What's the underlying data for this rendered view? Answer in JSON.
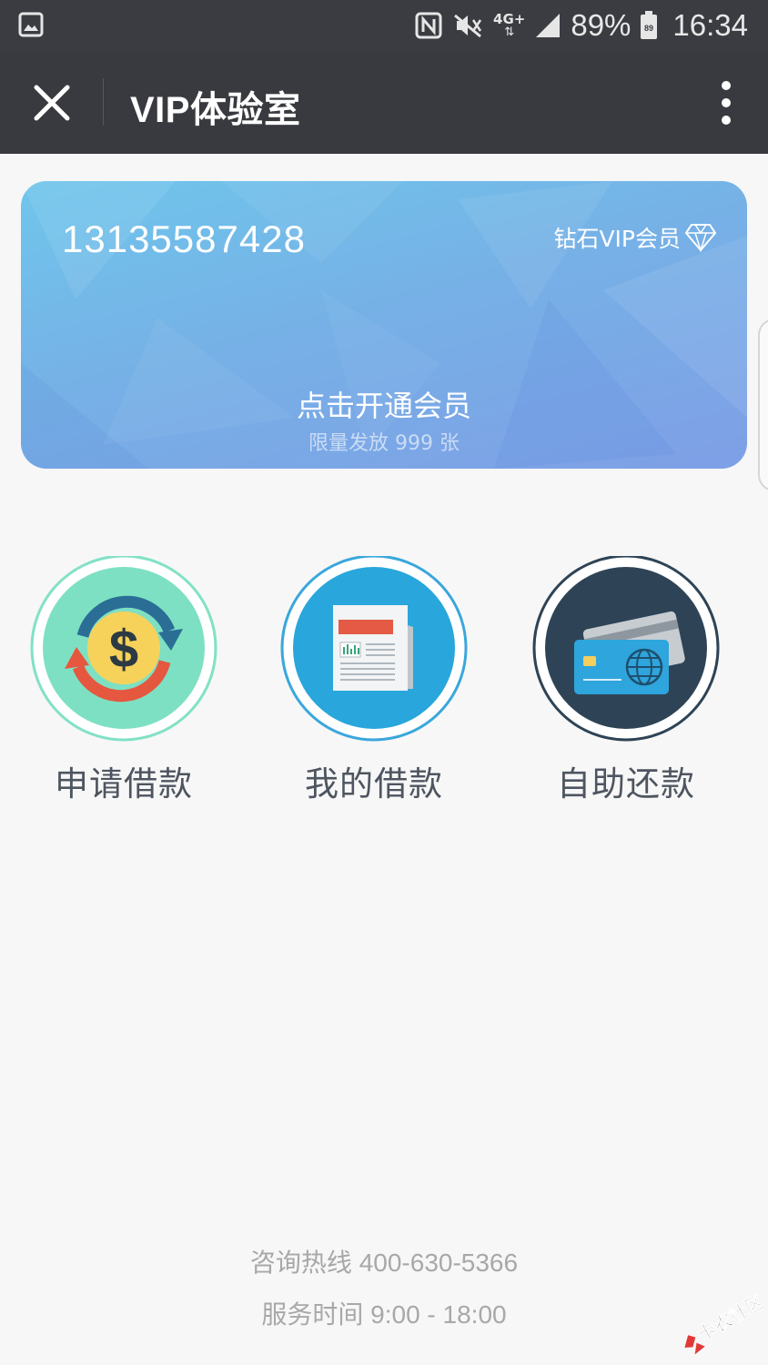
{
  "status_bar": {
    "battery_percent_label": "89%",
    "battery_level": "89",
    "time": "16:34",
    "network_type": "4G+",
    "icons": [
      "gallery-icon",
      "nfc-icon",
      "mute-icon",
      "network-icon",
      "signal-icon",
      "battery-icon"
    ]
  },
  "toolbar": {
    "title": "VIP体验室",
    "close_icon": "close-icon",
    "more_icon": "more-vertical-icon"
  },
  "vip_card": {
    "phone": "13135587428",
    "level": "钻石VIP会员",
    "level_icon": "diamond-icon",
    "action": "点击开通会员",
    "limit_note": "限量发放 999 张"
  },
  "menu": [
    {
      "label": "申请借款",
      "icon": "money-exchange-icon",
      "color": "#7ee0c3"
    },
    {
      "label": "我的借款",
      "icon": "newspaper-icon",
      "color": "#29a6db"
    },
    {
      "label": "自助还款",
      "icon": "bank-card-icon",
      "color": "#2e4456"
    }
  ],
  "footer": {
    "hotline": "咨询热线 400-630-5366",
    "hours": "服务时间 9:00 - 18:00"
  },
  "watermark": {
    "text": "卡农社区"
  }
}
